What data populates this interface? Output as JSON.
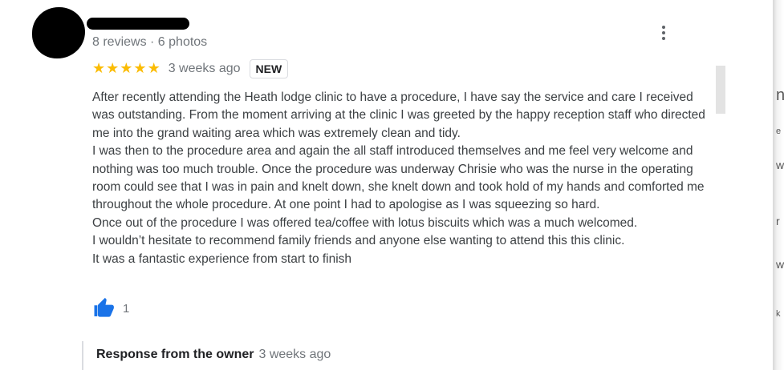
{
  "reviewer": {
    "meta": "8 reviews · 6 photos"
  },
  "review": {
    "stars": [
      "★",
      "★",
      "★",
      "★",
      "★"
    ],
    "date": "3 weeks ago",
    "badge": "NEW",
    "paragraphs": [
      "After recently attending the Heath lodge clinic to have a procedure, I have say the service and care I received was outstanding. From the moment arriving at the clinic I was greeted by the happy reception staff who directed me into the grand waiting area which was extremely clean and tidy.",
      "I was then to the procedure area and again the all staff introduced themselves and me feel very welcome and nothing was too much trouble. Once the procedure was underway Chrisie who was the nurse in the operating room could see that I was in pain and knelt down, she knelt down and took hold of my hands and comforted me throughout the whole procedure. At one point I had to apologise as I was squeezing so hard.",
      "Once out of the procedure I was offered tea/coffee with lotus biscuits which was a much welcomed.",
      "I wouldn’t hesitate to recommend family friends and anyone else wanting to attend this this clinic.",
      "It was a fantastic experience from start to finish"
    ],
    "likes": "1"
  },
  "owner_response": {
    "label": "Response from the owner",
    "date": "3 weeks ago"
  },
  "edge_glyphs": [
    "n",
    "e",
    "w",
    "r",
    "w",
    "k"
  ],
  "colors": {
    "star": "#fbbc04",
    "like": "#1a73e8",
    "meta_text": "#70757a"
  },
  "icons": {
    "more": "more-vert-icon",
    "like": "thumb-up-icon",
    "star": "star-icon"
  }
}
